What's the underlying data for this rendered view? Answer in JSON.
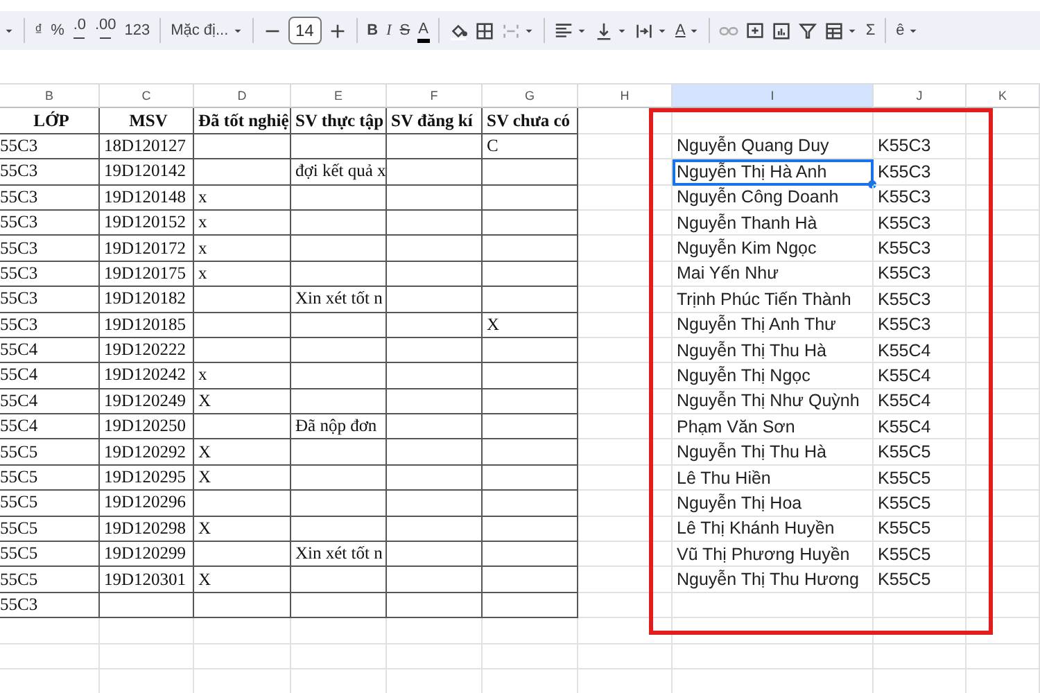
{
  "toolbar": {
    "groups": [
      [
        {
          "kind": "caret",
          "dropdown": true
        }
      ],
      [
        {
          "kind": "text",
          "text": "₫",
          "dropdown": false
        },
        {
          "kind": "text",
          "text": "%",
          "dropdown": false
        },
        {
          "kind": "decimal",
          "text": ".0",
          "dropdown": false
        },
        {
          "kind": "decimal",
          "text": ".00",
          "dropdown": false
        },
        {
          "kind": "text",
          "text": "123",
          "dropdown": false
        }
      ],
      [
        {
          "kind": "menu",
          "text": "Mặc đị...",
          "dropdown": true
        }
      ],
      [
        {
          "kind": "icon",
          "dropdown": false
        },
        {
          "kind": "field",
          "text": "14",
          "dropdown": false
        },
        {
          "kind": "icon",
          "dropdown": false
        }
      ],
      [
        {
          "kind": "bold",
          "text": "B",
          "dropdown": false
        },
        {
          "kind": "italic",
          "text": "I",
          "dropdown": false
        },
        {
          "kind": "strike",
          "text": "S",
          "dropdown": false
        },
        {
          "kind": "underbar",
          "text": "A",
          "dropdown": false
        }
      ],
      [
        {
          "kind": "icon",
          "dropdown": false
        },
        {
          "kind": "icon",
          "dropdown": false
        },
        {
          "kind": "icon",
          "dropdown": true
        }
      ],
      [
        {
          "kind": "icon",
          "dropdown": true
        },
        {
          "kind": "icon",
          "dropdown": true
        },
        {
          "kind": "icon",
          "dropdown": true
        },
        {
          "kind": "underline",
          "text": "A",
          "dropdown": true
        }
      ],
      [
        {
          "kind": "icon",
          "dropdown": false
        },
        {
          "kind": "icon",
          "dropdown": false
        },
        {
          "kind": "icon",
          "dropdown": false
        },
        {
          "kind": "icon",
          "dropdown": false
        },
        {
          "kind": "icon",
          "dropdown": true
        },
        {
          "kind": "text",
          "text": "Σ",
          "dropdown": false
        }
      ],
      [
        {
          "kind": "text",
          "text": "ê",
          "dropdown": true
        }
      ]
    ]
  },
  "column_headers": [
    {
      "label": "B",
      "selected": false
    },
    {
      "label": "C",
      "selected": false
    },
    {
      "label": "D",
      "selected": false
    },
    {
      "label": "E",
      "selected": false
    },
    {
      "label": "F",
      "selected": false
    },
    {
      "label": "G",
      "selected": false
    },
    {
      "label": "H",
      "selected": false
    },
    {
      "label": "I",
      "selected": true
    },
    {
      "label": "J",
      "selected": false
    },
    {
      "label": "K",
      "selected": false
    }
  ],
  "left_table": {
    "columns": [
      "LỚP",
      "MSV",
      "Đã tốt nghiệ",
      "SV thực tập",
      "SV đăng kí",
      "SV chưa có"
    ],
    "rows": [
      {
        "lop": "55C3",
        "msv": "18D120127",
        "chua_co": "C"
      },
      {
        "lop": "55C3",
        "msv": "19D120142",
        "thuc_tap": "đợi kết quả x"
      },
      {
        "lop": "55C3",
        "msv": "19D120148",
        "tot_nghiep": "x"
      },
      {
        "lop": "55C3",
        "msv": "19D120152",
        "tot_nghiep": "x"
      },
      {
        "lop": "55C3",
        "msv": "19D120172",
        "tot_nghiep": "x"
      },
      {
        "lop": "55C3",
        "msv": "19D120175",
        "tot_nghiep": "x"
      },
      {
        "lop": "55C3",
        "msv": "19D120182",
        "thuc_tap": "Xin xét tốt n"
      },
      {
        "lop": "55C3",
        "msv": "19D120185",
        "chua_co": "X"
      },
      {
        "lop": "55C4",
        "msv": "19D120222"
      },
      {
        "lop": "55C4",
        "msv": "19D120242",
        "tot_nghiep": "x"
      },
      {
        "lop": "55C4",
        "msv": "19D120249",
        "tot_nghiep": "X"
      },
      {
        "lop": "55C4",
        "msv": "19D120250",
        "thuc_tap": "Đã nộp đơn"
      },
      {
        "lop": "55C5",
        "msv": "19D120292",
        "tot_nghiep": "X"
      },
      {
        "lop": "55C5",
        "msv": "19D120295",
        "tot_nghiep": "X"
      },
      {
        "lop": "55C5",
        "msv": "19D120296"
      },
      {
        "lop": "55C5",
        "msv": "19D120298",
        "tot_nghiep": "X"
      },
      {
        "lop": "55C5",
        "msv": "19D120299",
        "thuc_tap": "Xin xét tốt n"
      },
      {
        "lop": "55C5",
        "msv": "19D120301",
        "tot_nghiep": "X"
      },
      {
        "lop": "55C3"
      }
    ]
  },
  "right_table": {
    "rows": [
      {
        "name": "Nguyễn Quang Duy",
        "class": "K55C3",
        "selected": false
      },
      {
        "name": "Nguyễn Thị Hà Anh",
        "class": "K55C3",
        "selected": true
      },
      {
        "name": "Nguyễn Công Doanh",
        "class": "K55C3",
        "selected": false
      },
      {
        "name": "Nguyễn Thanh Hà",
        "class": "K55C3",
        "selected": false
      },
      {
        "name": "Nguyễn Kim Ngọc",
        "class": "K55C3",
        "selected": false
      },
      {
        "name": "Mai Yến Như",
        "class": "K55C3",
        "selected": false
      },
      {
        "name": "Trịnh Phúc Tiến Thành",
        "class": "K55C3",
        "selected": false
      },
      {
        "name": "Nguyễn Thị Anh Thư",
        "class": "K55C3",
        "selected": false
      },
      {
        "name": "Nguyễn Thị Thu Hà",
        "class": "K55C4",
        "selected": false
      },
      {
        "name": "Nguyễn Thị Ngọc",
        "class": "K55C4",
        "selected": false
      },
      {
        "name": "Nguyễn Thị Như Quỳnh",
        "class": "K55C4",
        "selected": false
      },
      {
        "name": "Phạm Văn Sơn",
        "class": "K55C4",
        "selected": false
      },
      {
        "name": "Nguyễn Thị Thu Hà",
        "class": "K55C5",
        "selected": false
      },
      {
        "name": "Lê Thu Hiền",
        "class": "K55C5",
        "selected": false
      },
      {
        "name": "Nguyễn Thị Hoa",
        "class": "K55C5",
        "selected": false
      },
      {
        "name": "Lê Thị Khánh Huyền",
        "class": "K55C5",
        "selected": false
      },
      {
        "name": "Vũ Thị Phương Huyền",
        "class": "K55C5",
        "selected": false
      },
      {
        "name": "Nguyễn Thị Thu Hương",
        "class": "K55C5",
        "selected": false
      }
    ]
  }
}
